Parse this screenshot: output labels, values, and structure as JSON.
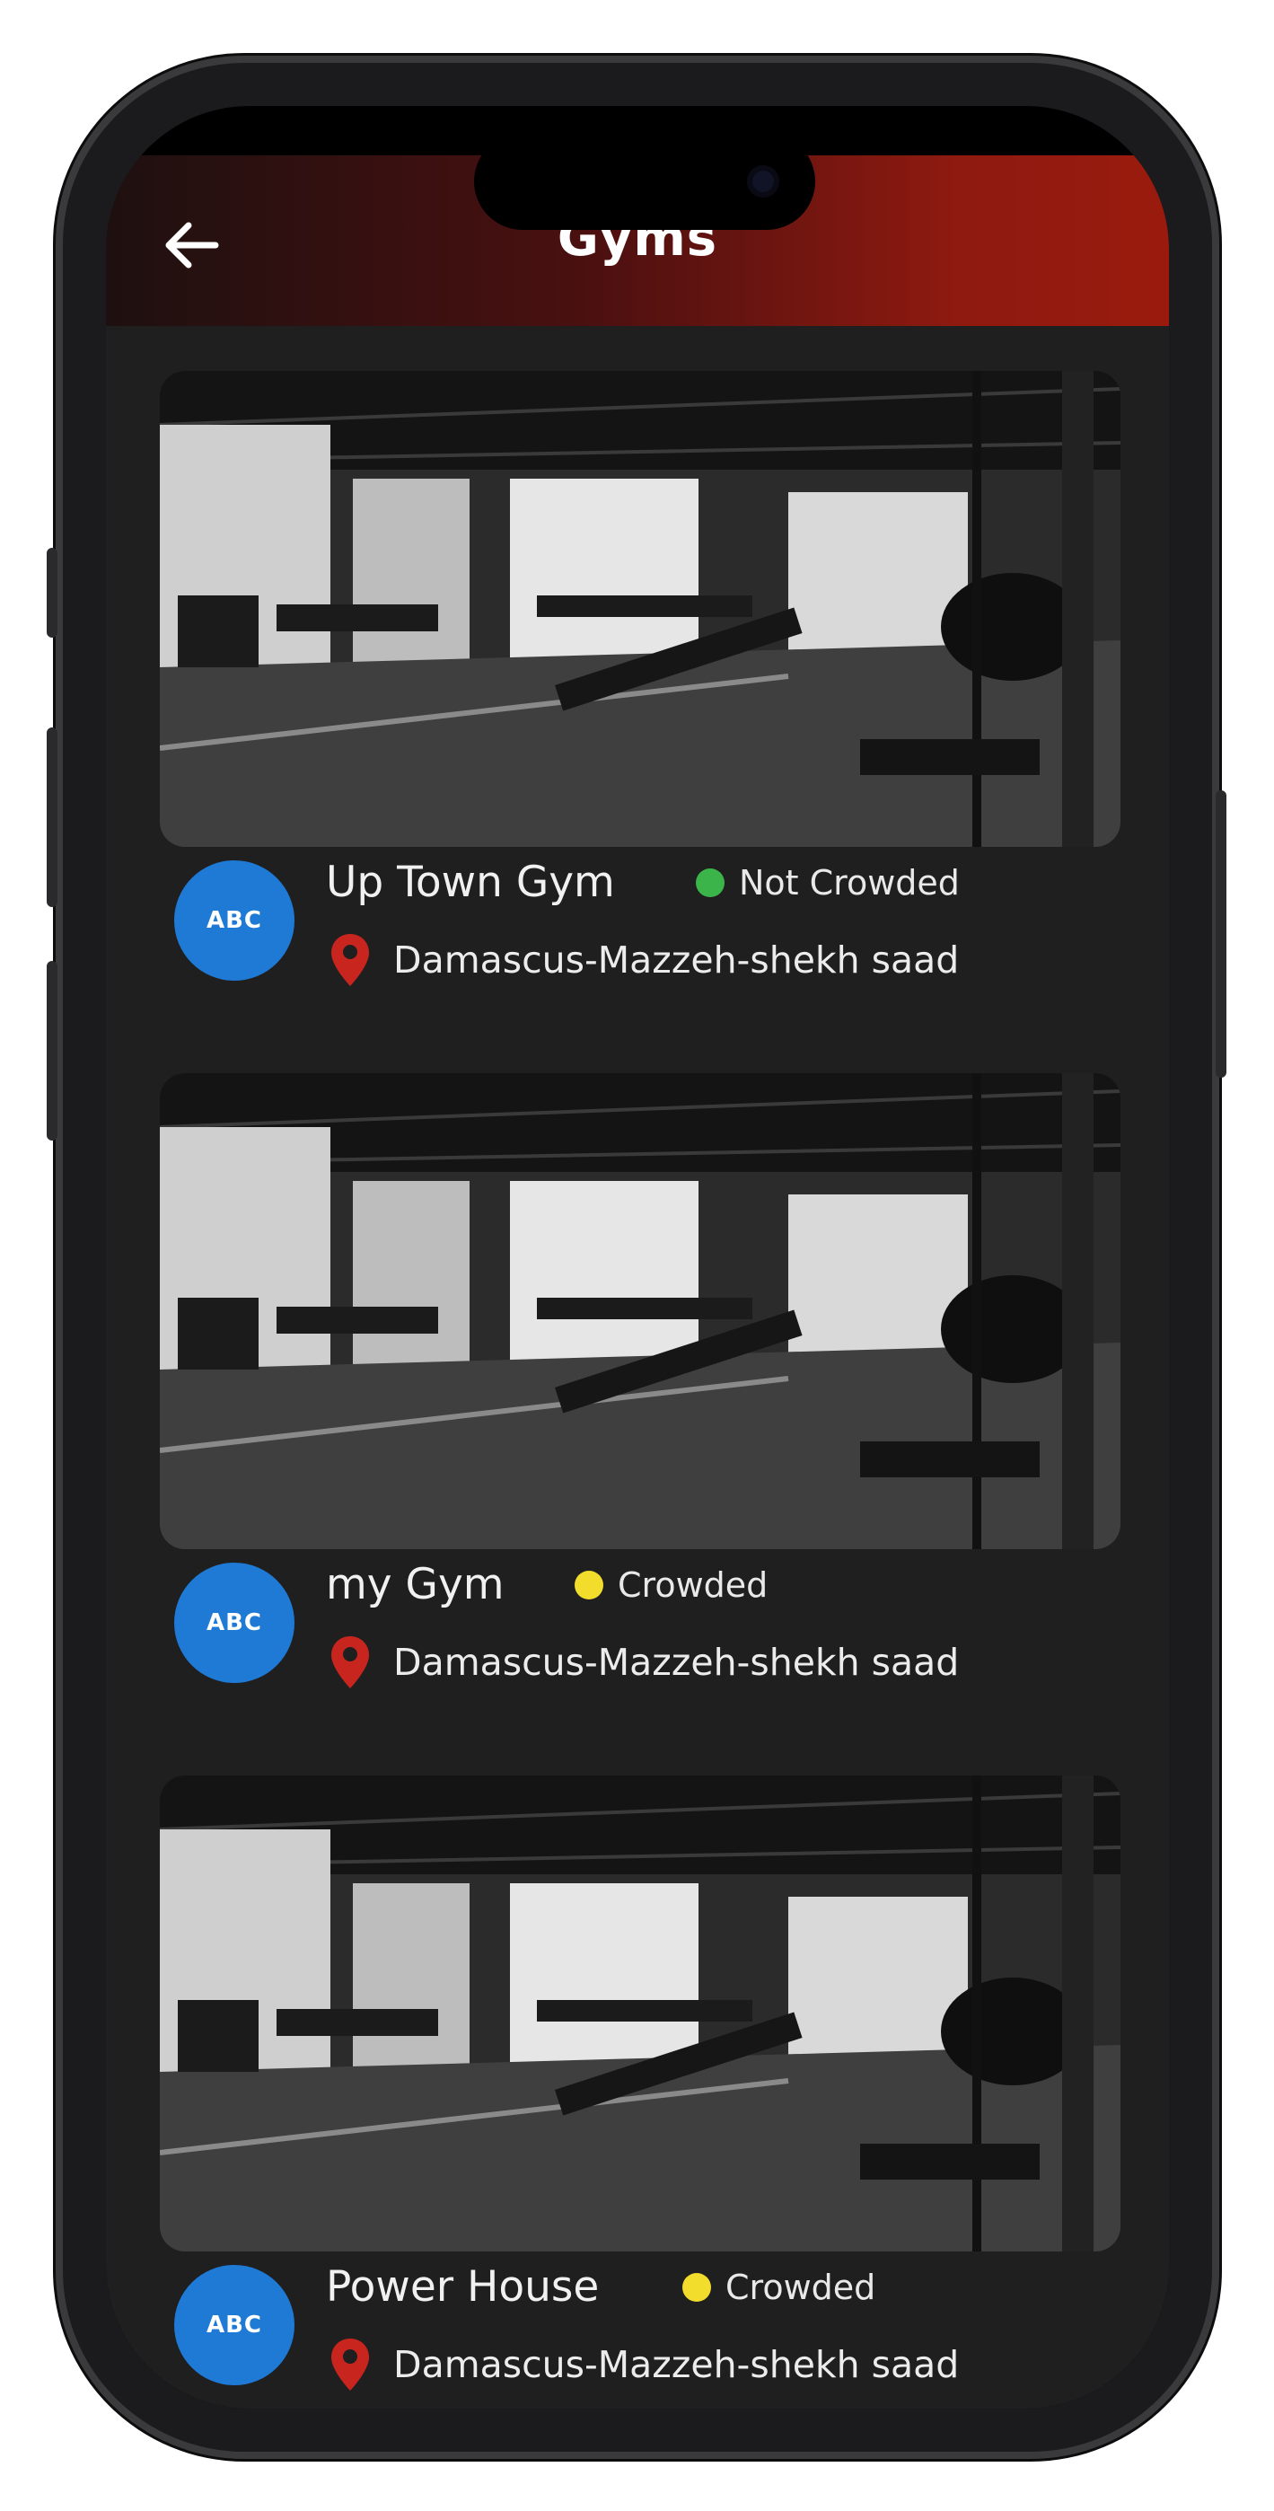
{
  "header": {
    "title": "Gyms"
  },
  "gyms": [
    {
      "name": "Up Town Gym",
      "status": "Not Crowded",
      "status_color": "#3bb54a",
      "location": "Damascus-Mazzeh-shekh saad",
      "avatar": "ABC"
    },
    {
      "name": "my Gym",
      "status": "Crowded",
      "status_color": "#f2dd2c",
      "location": "Damascus-Mazzeh-shekh saad",
      "avatar": "ABC"
    },
    {
      "name": "Power House",
      "status": "Crowded",
      "status_color": "#f2dd2c",
      "location": "Damascus-Mazzeh-shekh saad",
      "avatar": "ABC"
    }
  ],
  "colors": {
    "accent": "#9a1b0e",
    "avatar_bg": "#1f7ad6",
    "pin": "#c9251f"
  },
  "icons": {
    "back": "back-arrow-icon",
    "pin": "location-pin-icon",
    "photo": "gym-photo"
  }
}
